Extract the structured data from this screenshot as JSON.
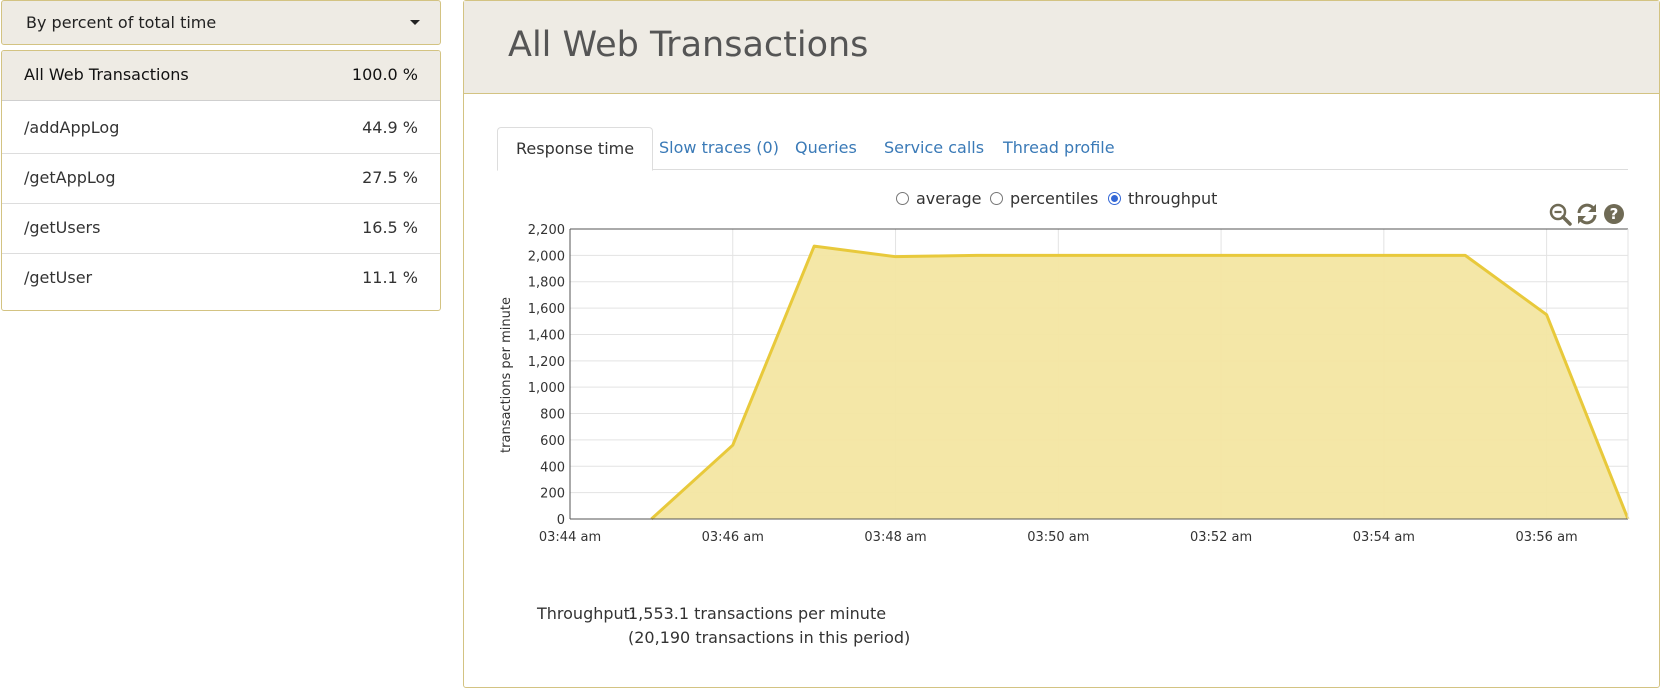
{
  "sidebar": {
    "sort_dropdown": {
      "label": "By percent of total time",
      "icon": "caret-down-icon"
    },
    "transactions": [
      {
        "name": "All Web Transactions",
        "percent": "100.0 %"
      },
      {
        "name": "/addAppLog",
        "percent": "44.9 %"
      },
      {
        "name": "/getAppLog",
        "percent": "27.5 %"
      },
      {
        "name": "/getUsers",
        "percent": "16.5 %"
      },
      {
        "name": "/getUser",
        "percent": "11.1 %"
      }
    ]
  },
  "main": {
    "title": "All Web Transactions",
    "tabs": [
      {
        "label": "Response time",
        "active": true
      },
      {
        "label": "Slow traces (0)",
        "active": false
      },
      {
        "label": "Queries",
        "active": false
      },
      {
        "label": "Service calls",
        "active": false
      },
      {
        "label": "Thread profile",
        "active": false
      }
    ],
    "view_options": [
      {
        "label": "average",
        "checked": false
      },
      {
        "label": "percentiles",
        "checked": false
      },
      {
        "label": "throughput",
        "checked": true
      }
    ],
    "tools": [
      "zoom-out-icon",
      "refresh-icon",
      "help-icon"
    ],
    "summary": {
      "label": "Throughput:",
      "line1": "1,553.1 transactions per minute",
      "line2": "(20,190 transactions in this period)"
    }
  },
  "colors": {
    "accent_border": "#d3c382",
    "header_bg": "#eeebe4",
    "link": "#3a7ab7",
    "series_fill": "#f3e6a2",
    "series_line": "#e8c93b"
  },
  "chart_data": {
    "type": "area",
    "title": "",
    "xlabel": "",
    "ylabel": "transactions per minute",
    "ylim": [
      0,
      2200
    ],
    "yticks": [
      "0",
      "200",
      "400",
      "600",
      "800",
      "1,000",
      "1,200",
      "1,400",
      "1,600",
      "1,800",
      "2,000",
      "2,200"
    ],
    "xticks": [
      "03:44 am",
      "03:46 am",
      "03:48 am",
      "03:50 am",
      "03:52 am",
      "03:54 am",
      "03:56 am"
    ],
    "grid": true,
    "series": [
      {
        "x": [
          "03:45 am",
          "03:46 am",
          "03:47 am",
          "03:48 am",
          "03:49 am",
          "03:50 am",
          "03:51 am",
          "03:52 am",
          "03:53 am",
          "03:54 am",
          "03:55 am",
          "03:56 am",
          "03:57 am"
        ],
        "values": [
          0,
          560,
          2070,
          1990,
          2000,
          2000,
          2000,
          2000,
          2000,
          2000,
          2000,
          1550,
          0
        ]
      }
    ]
  }
}
